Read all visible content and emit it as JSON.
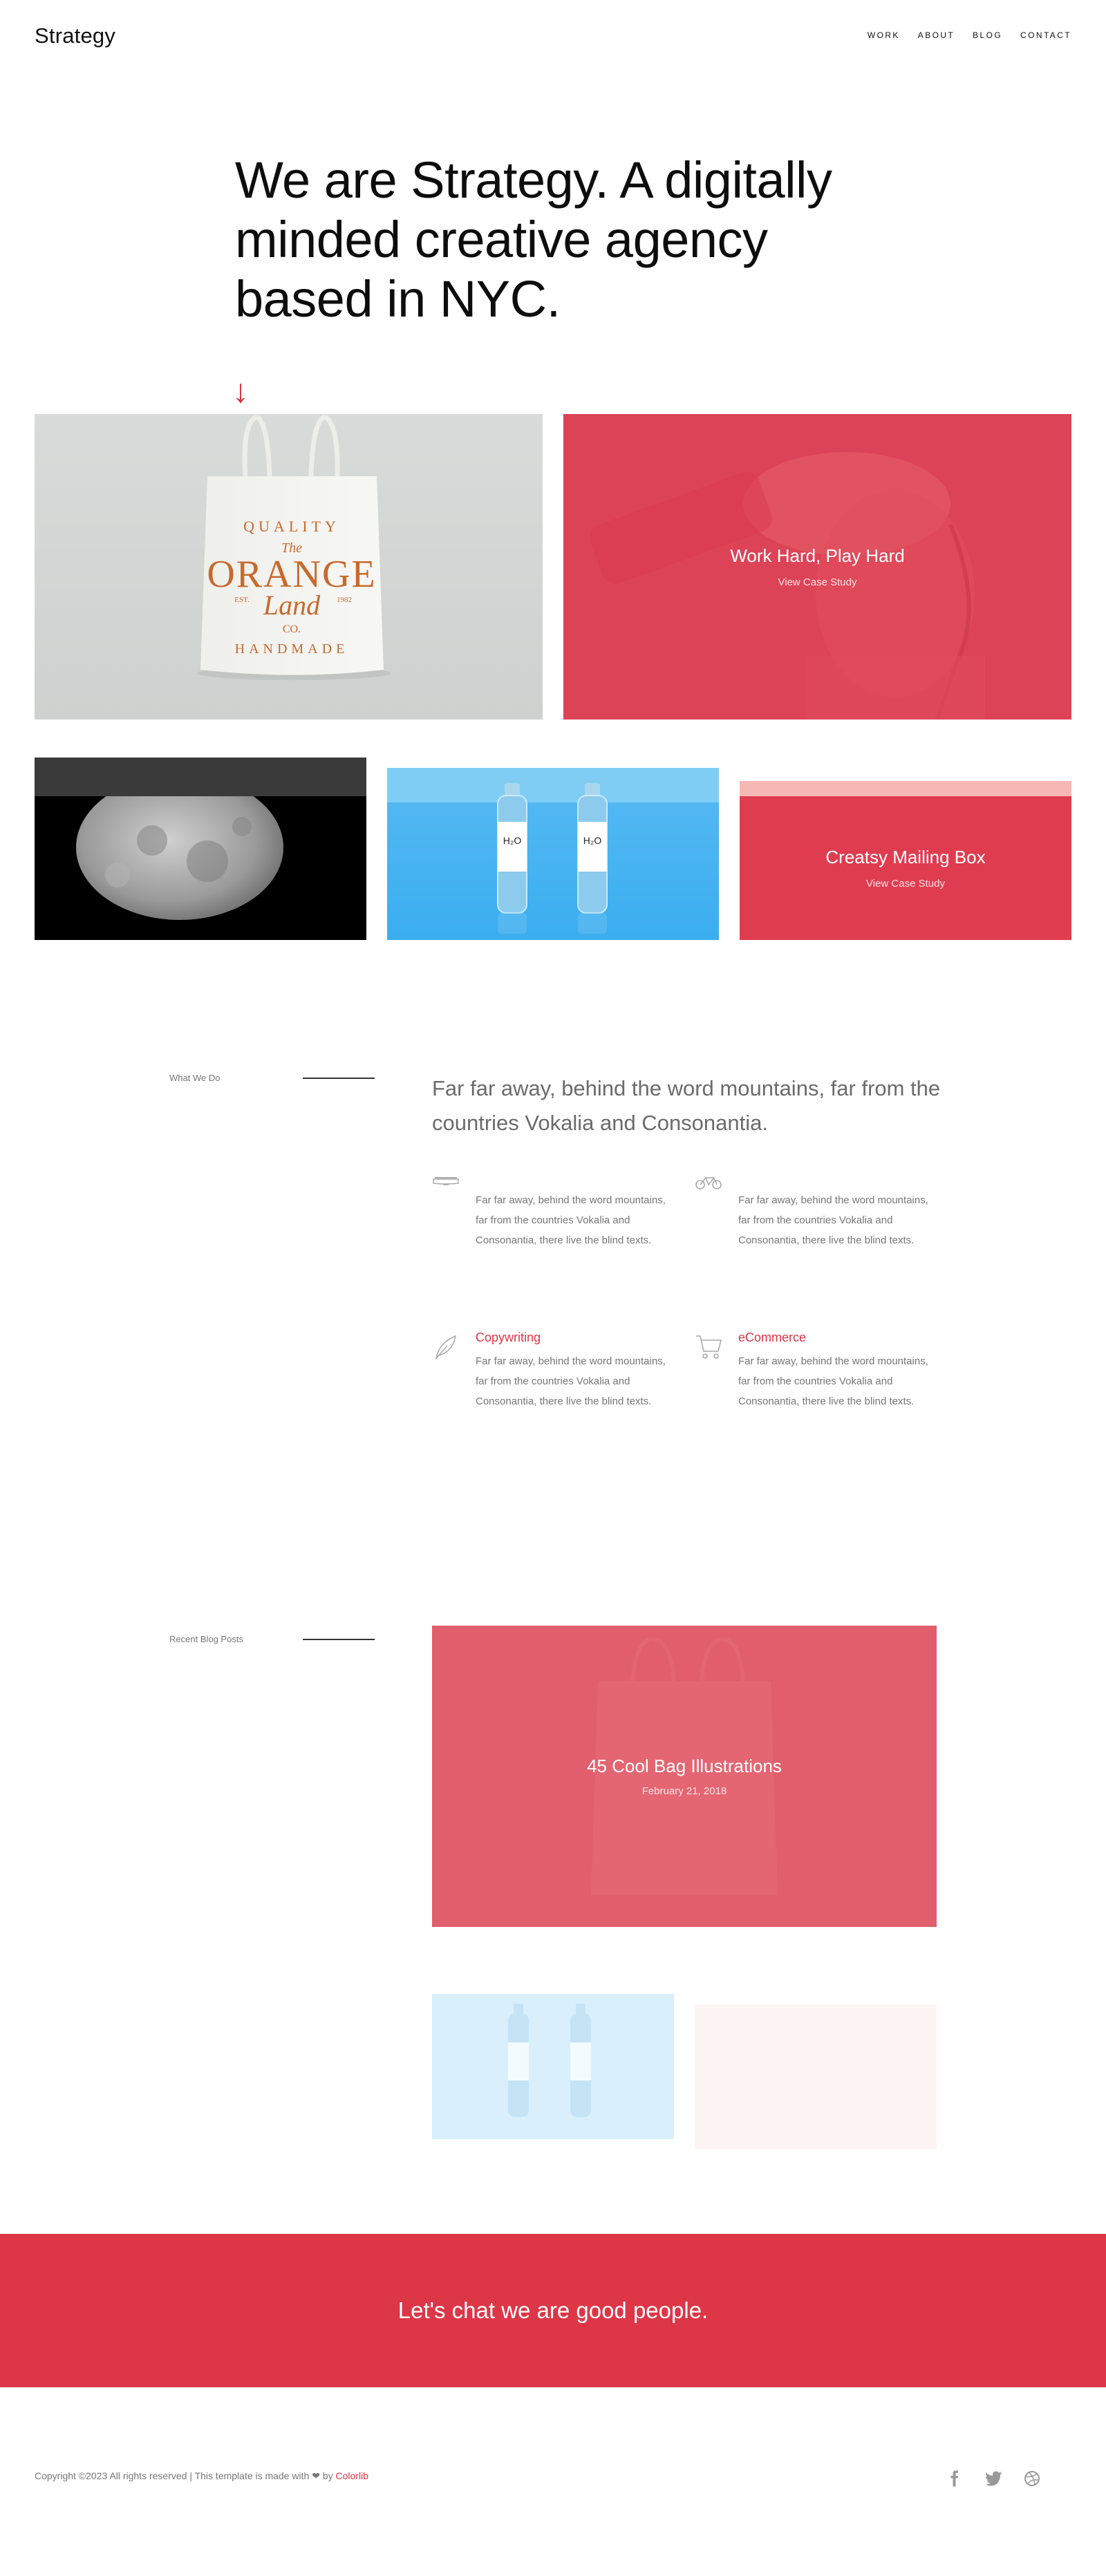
{
  "header": {
    "logo": "Strategy",
    "nav": [
      "Work",
      "About",
      "Blog",
      "Contact"
    ]
  },
  "hero": {
    "title": "We are Strategy. A digitally minded creative agency based in NYC.",
    "arrow_icon": "arrow-down-icon"
  },
  "work": {
    "tiles": [
      {
        "name": "orange-land-tote-bag",
        "title": "",
        "link": ""
      },
      {
        "name": "work-hard-play-hard",
        "title": "Work Hard, Play Hard",
        "link": "View Case Study"
      },
      {
        "name": "moon",
        "title": "",
        "link": ""
      },
      {
        "name": "h2o-bottles",
        "title": "",
        "link": ""
      },
      {
        "name": "creatsy-mailing-box",
        "title": "Creatsy Mailing Box",
        "link": "View Case Study"
      }
    ],
    "bag_print": {
      "top": "QUALITY",
      "the": "The",
      "main": "ORANGE",
      "est": "EST.",
      "year": "1982",
      "land": "Land",
      "co": "CO.",
      "bottom": "HANDMADE"
    },
    "bottle_label": "H₂O"
  },
  "what_we_do": {
    "label": "What We Do",
    "lead": "Far far away, behind the word mountains, far from the countries Vokalia and Consonantia.",
    "services": [
      {
        "icon": "monitor-icon",
        "title": "",
        "text": "Far far away, behind the word mountains, far from the countries Vokalia and Consonantia, there live the blind texts."
      },
      {
        "icon": "bicycle-icon",
        "title": "",
        "text": "Far far away, behind the word mountains, far from the countries Vokalia and Consonantia, there live the blind texts."
      },
      {
        "icon": "feather-pen-icon",
        "title": "Copywriting",
        "text": "Far far away, behind the word mountains, far from the countries Vokalia and Consonantia, there live the blind texts."
      },
      {
        "icon": "shopping-cart-icon",
        "title": "eCommerce",
        "text": "Far far away, behind the word mountains, far from the countries Vokalia and Consonantia, there live the blind texts."
      }
    ]
  },
  "blog": {
    "label": "Recent Blog Posts",
    "posts": [
      {
        "title": "45 Cool Bag Illustrations",
        "date": "February 21, 2018"
      }
    ]
  },
  "cta": {
    "text": "Let's chat we are good people."
  },
  "footer": {
    "copyright": "Copyright ©2023 All rights reserved | This template is made with",
    "by": "by",
    "brand": "Colorlib",
    "social": [
      "facebook-icon",
      "twitter-icon",
      "dribbble-icon"
    ]
  },
  "colors": {
    "accent": "#dc3545",
    "tile_red": "#dd4356",
    "cta_red": "#dd3647",
    "water_blue": "#3aaef0"
  }
}
